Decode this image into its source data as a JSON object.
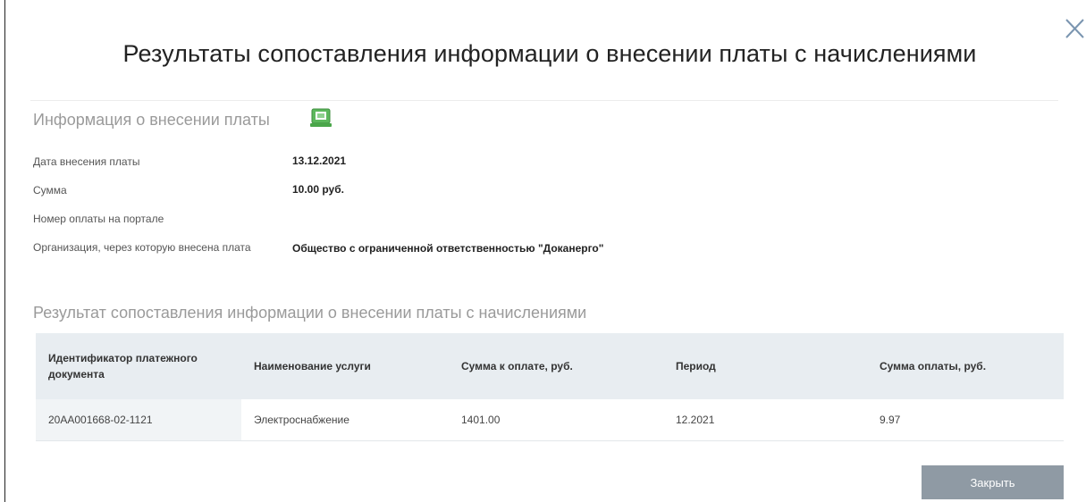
{
  "dialog": {
    "title": "Результаты сопоставления информации о внесении платы с начислениями"
  },
  "payment_info": {
    "heading": "Информация о внесении платы",
    "export_icon": "excel-export-icon",
    "rows": [
      {
        "label": "Дата внесения платы",
        "value": "13.12.2021"
      },
      {
        "label": "Сумма",
        "value": "10.00 руб."
      },
      {
        "label": "Номер оплаты на портале",
        "value": ""
      },
      {
        "label": "Организация, через которую внесена плата",
        "value": "Общество с ограниченной ответственностью \"Доканерго\""
      }
    ]
  },
  "matching": {
    "heading": "Результат сопоставления информации о внесении платы с начислениями",
    "columns": [
      "Идентификатор платежного документа",
      "Наименование услуги",
      "Сумма к оплате, руб.",
      "Период",
      "Сумма оплаты, руб."
    ],
    "rows": [
      [
        "20АА001668-02-1121",
        "Электроснабжение",
        "1401.00",
        "12.2021",
        "9.97"
      ]
    ]
  },
  "footer": {
    "close_label": "Закрыть"
  },
  "colors": {
    "header_bg": "#e8edf1",
    "button_bg": "#8f9aa4",
    "heading_gray": "#9a9a9a"
  }
}
